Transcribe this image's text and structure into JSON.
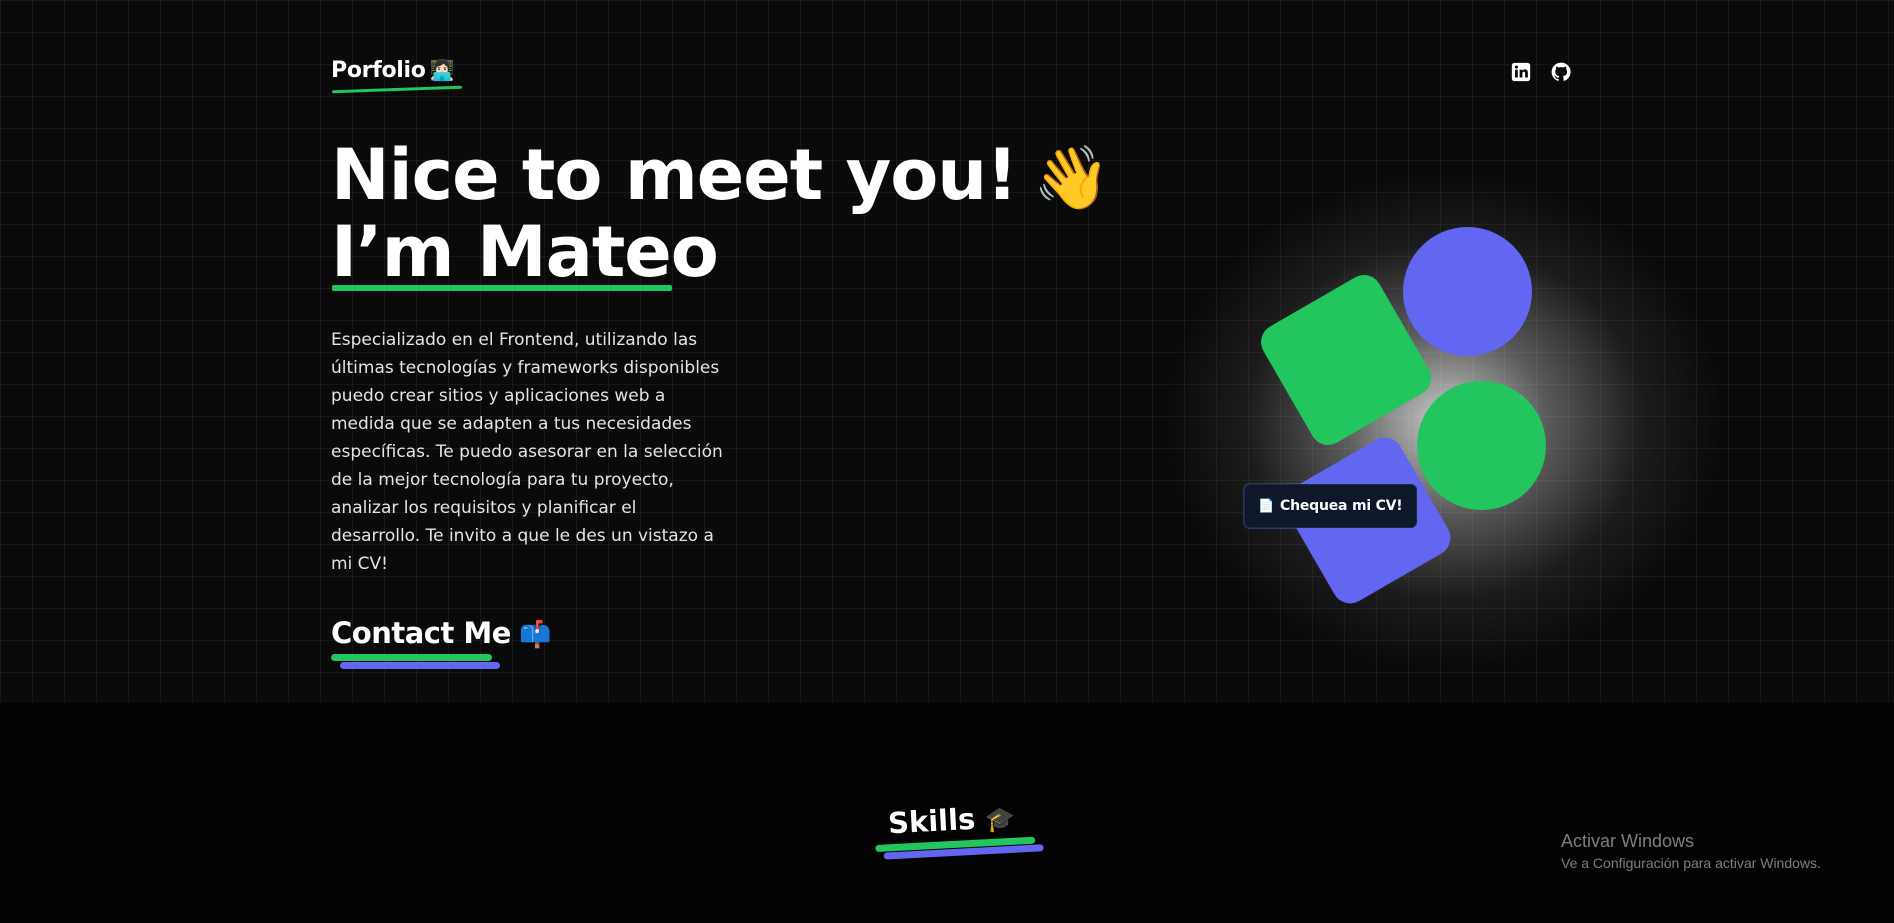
{
  "header": {
    "logo_text": "Porfolio",
    "logo_emoji": "👩🏻‍💻",
    "social": [
      {
        "name": "linkedin-icon"
      },
      {
        "name": "github-icon"
      }
    ]
  },
  "hero": {
    "title_line1": "Nice to meet you!",
    "wave_emoji": "👋",
    "title_line2": "I’m Mateo",
    "description": "Especializado en el Frontend, utilizando las últimas tecnologías y frameworks disponibles puedo crear sitios y aplicaciones web a medida que se adapten a tus necesidades específicas. Te puedo asesorar en la selección de la mejor tecnología para tu proyecto, analizar los requisitos y planificar el desarrollo. Te invito a que le des un vistazo a mi CV!",
    "contact_label": "Contact Me",
    "contact_emoji": "📫"
  },
  "visual": {
    "cv_button_icon": "📄",
    "cv_button_label": "Chequea mi CV!"
  },
  "skills": {
    "title": "Skills",
    "emoji": "🎓"
  },
  "os_watermark": {
    "title": "Activar Windows",
    "subtitle": "Ve a Configuración para activar Windows."
  },
  "colors": {
    "accent_green": "#22c55e",
    "accent_indigo": "#6366f1",
    "background": "#0a0a0a"
  }
}
